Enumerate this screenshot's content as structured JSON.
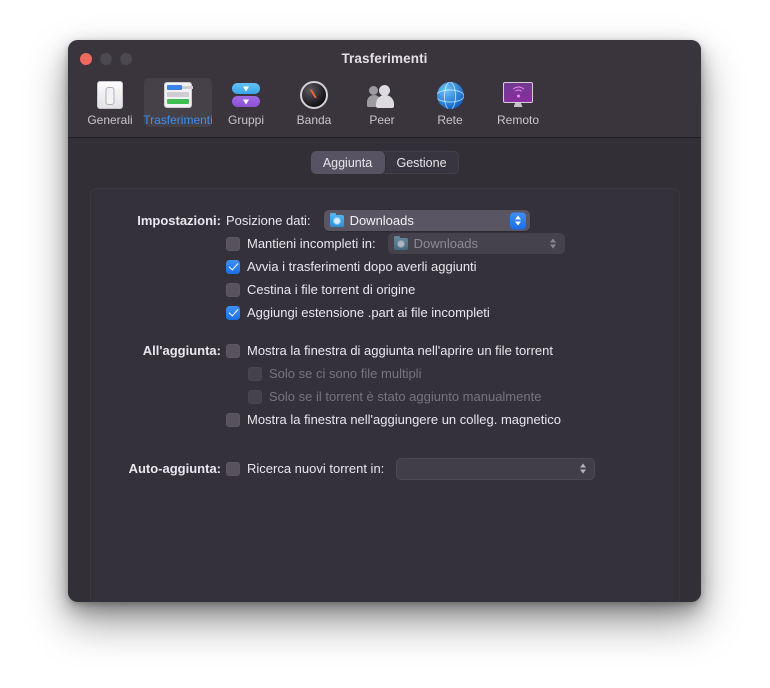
{
  "window": {
    "title": "Trasferimenti",
    "traffic_lights": [
      "close",
      "minimize",
      "zoom"
    ]
  },
  "toolbar": {
    "items": [
      {
        "label": "Generali",
        "icon": "generali-icon",
        "selected": false
      },
      {
        "label": "Trasferimenti",
        "icon": "trasferimenti-icon",
        "selected": true
      },
      {
        "label": "Gruppi",
        "icon": "gruppi-icon",
        "selected": false
      },
      {
        "label": "Banda",
        "icon": "banda-icon",
        "selected": false
      },
      {
        "label": "Peer",
        "icon": "peer-icon",
        "selected": false
      },
      {
        "label": "Rete",
        "icon": "rete-icon",
        "selected": false
      },
      {
        "label": "Remoto",
        "icon": "remoto-icon",
        "selected": false
      }
    ]
  },
  "tabs": {
    "items": [
      {
        "label": "Aggiunta",
        "active": true
      },
      {
        "label": "Gestione",
        "active": false
      }
    ]
  },
  "form": {
    "groups": [
      {
        "side_label": "Impostazioni:",
        "rows": [
          {
            "kind": "popup",
            "field_label": "Posizione dati:",
            "popup_value": "Downloads",
            "popup_icon": "folder-downloads-icon",
            "enabled": true
          },
          {
            "kind": "checkbox-popup",
            "checkbox_label": "Mantieni incompleti in:",
            "checked": false,
            "popup_value": "Downloads",
            "popup_icon": "folder-downloads-icon",
            "popup_enabled": false
          },
          {
            "kind": "checkbox",
            "checkbox_label": "Avvia i trasferimenti dopo averli aggiunti",
            "checked": true,
            "disabled": false
          },
          {
            "kind": "checkbox",
            "checkbox_label": "Cestina i file torrent di origine",
            "checked": false,
            "disabled": false
          },
          {
            "kind": "checkbox",
            "checkbox_label": "Aggiungi estensione .part ai file incompleti",
            "checked": true,
            "disabled": false
          }
        ]
      },
      {
        "side_label": "All'aggiunta:",
        "rows": [
          {
            "kind": "checkbox",
            "checkbox_label": "Mostra la finestra di aggiunta nell'aprire un file torrent",
            "checked": false,
            "disabled": false
          },
          {
            "kind": "checkbox",
            "checkbox_label": "Solo se ci sono file multipli",
            "checked": false,
            "disabled": true,
            "indented": true
          },
          {
            "kind": "checkbox",
            "checkbox_label": "Solo se il torrent è stato aggiunto manualmente",
            "checked": false,
            "disabled": true,
            "indented": true
          },
          {
            "kind": "checkbox",
            "checkbox_label": "Mostra la finestra nell'aggiungere un colleg. magnetico",
            "checked": false,
            "disabled": false
          }
        ]
      },
      {
        "side_label": "Auto-aggiunta:",
        "rows": [
          {
            "kind": "checkbox-popup",
            "checkbox_label": "Ricerca nuovi torrent in:",
            "checked": false,
            "popup_value": "",
            "popup_enabled": false,
            "blank": true
          }
        ]
      }
    ]
  },
  "colors": {
    "window_bg": "#332f36",
    "titlebar_bg": "#3a353d",
    "panel_bg": "#35313a",
    "accent_blue": "#1a6fe8",
    "selected_toolbar_label": "#3b8ff0",
    "close_red": "#ed6a5f",
    "text_primary": "#e9e7ec",
    "text_disabled": "#78737f"
  }
}
